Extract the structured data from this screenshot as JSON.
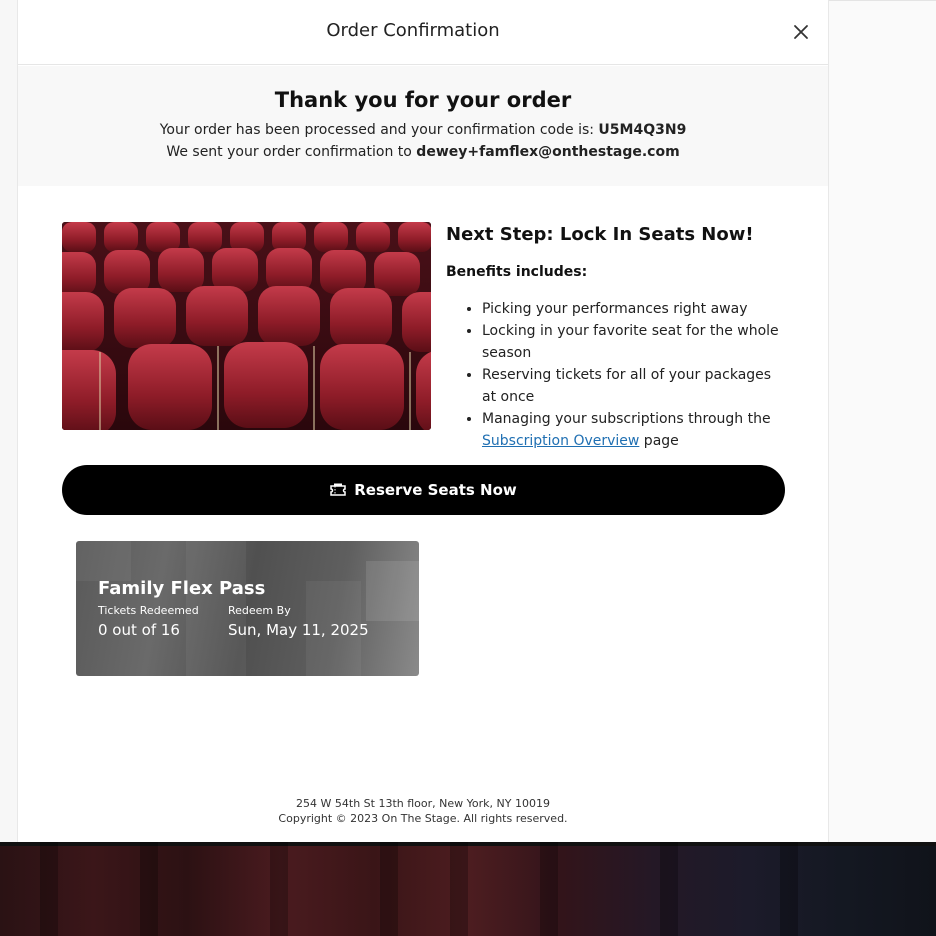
{
  "modal": {
    "title": "Order Confirmation",
    "close_icon": "close-icon"
  },
  "thanks": {
    "title": "Thank you for your order",
    "processed_text": "Your order has been processed and your confirmation code is: ",
    "confirmation_code": "U5M4Q3N9",
    "sent_text": "We sent your order confirmation to ",
    "email": "dewey+famflex@onthestage.com"
  },
  "promo": {
    "image_icon": "theater-seats-photo",
    "title": "Next Step: Lock In Seats Now!",
    "benefits_label": "Benefits includes:",
    "benefits": [
      "Picking your performances right away",
      "Locking in your favorite seat for the whole season",
      "Reserving tickets for all of your packages at once"
    ],
    "benefit_last_prefix": "Managing your subscriptions through the ",
    "benefit_last_link": "Subscription Overview",
    "benefit_last_suffix": " page",
    "link_color": "#1f6fb2"
  },
  "reserve_button": {
    "label": "Reserve Seats Now",
    "icon": "ticket-icon",
    "color": "#000000"
  },
  "pass": {
    "name": "Family Flex Pass",
    "redeemed_label": "Tickets Redeemed",
    "redeemed_value": "0 out of 16",
    "redeem_by_label": "Redeem By",
    "redeem_by_value": "Sun, May 11, 2025"
  },
  "footer": {
    "address": "254 W 54th St 13th floor, New York, NY 10019",
    "copyright": "Copyright © 2023 On The Stage. All rights reserved."
  }
}
